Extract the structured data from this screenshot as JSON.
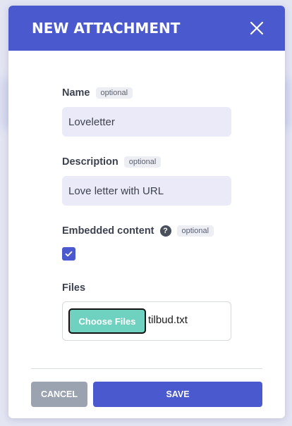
{
  "modal": {
    "title": "NEW ATTACHMENT",
    "close_icon": "close-icon"
  },
  "fields": {
    "name": {
      "label": "Name",
      "badge": "optional",
      "value": "Loveletter"
    },
    "description": {
      "label": "Description",
      "badge": "optional",
      "value": "Love letter with URL"
    },
    "embedded": {
      "label": "Embedded content",
      "help_icon": "question-icon",
      "help_glyph": "?",
      "badge": "optional",
      "checked": true
    },
    "files": {
      "label": "Files",
      "button_label": "Choose Files",
      "file_name": "tilbud.txt"
    }
  },
  "actions": {
    "cancel_label": "CANCEL",
    "save_label": "SAVE"
  },
  "colors": {
    "primary": "#4b59cf",
    "input_bg": "#ebeaf8",
    "file_button": "#6fd2c1",
    "cancel_button": "#9ca3b0"
  }
}
